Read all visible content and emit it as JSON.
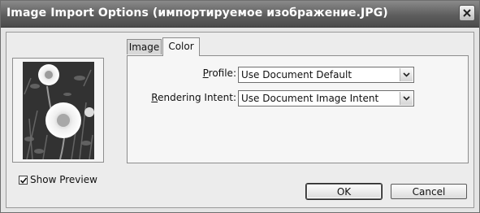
{
  "window": {
    "title": "Image Import Options (импортируемое изображение.JPG)",
    "close_icon": "close-icon"
  },
  "preview": {
    "image_description_icon": "dandelion-photo",
    "show_preview_label": "Show Preview",
    "show_preview_checked": true
  },
  "tabs": [
    {
      "label": "Image",
      "active": false
    },
    {
      "label": "Color",
      "active": true
    }
  ],
  "fields": {
    "profile": {
      "label_prefix": "",
      "label_mnemonic": "P",
      "label_rest": "rofile:",
      "value": "Use Document Default"
    },
    "rendering_intent": {
      "label_mnemonic": "R",
      "label_rest": "endering Intent:",
      "value": "Use Document Image Intent"
    }
  },
  "buttons": {
    "ok": "OK",
    "cancel": "Cancel"
  }
}
